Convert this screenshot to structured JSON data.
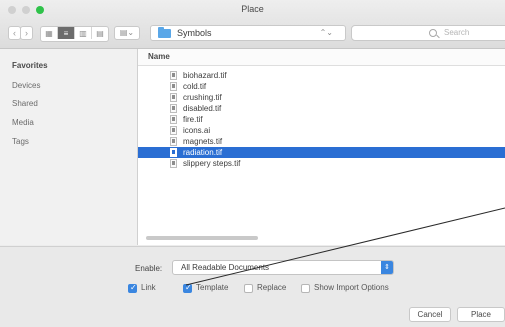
{
  "window": {
    "title": "Place"
  },
  "toolbar": {
    "back_label": "‹",
    "forward_label": "›",
    "view_icons": [
      "▦",
      "≡",
      "▥",
      "▤"
    ],
    "arrange_label": "▤⌄",
    "location": "Symbols",
    "location_arrows": "⌃⌄",
    "search_placeholder": "Search"
  },
  "sidebar": {
    "items": [
      {
        "label": "Favorites"
      },
      {
        "label": "Devices"
      },
      {
        "label": "Shared"
      },
      {
        "label": "Media"
      },
      {
        "label": "Tags"
      }
    ]
  },
  "file_list": {
    "column_header": "Name",
    "files": [
      {
        "name": "biohazard.tif",
        "selected": false
      },
      {
        "name": "cold.tif",
        "selected": false
      },
      {
        "name": "crushing.tif",
        "selected": false
      },
      {
        "name": "disabled.tif",
        "selected": false
      },
      {
        "name": "fire.tif",
        "selected": false
      },
      {
        "name": "icons.ai",
        "selected": false
      },
      {
        "name": "magnets.tif",
        "selected": false
      },
      {
        "name": "radiation.tif",
        "selected": true
      },
      {
        "name": "slippery steps.tif",
        "selected": false
      }
    ]
  },
  "options": {
    "enable_label": "Enable:",
    "enable_value": "All Readable Documents",
    "enable_arrow": "⇕",
    "link_label": "Link",
    "link_checked": true,
    "template_label": "Template",
    "template_checked": true,
    "replace_label": "Replace",
    "replace_checked": false,
    "import_label": "Show Import Options",
    "import_checked": false
  },
  "buttons": {
    "cancel": "Cancel",
    "place": "Place"
  },
  "colors": {
    "selection": "#2a6ed3",
    "accent": "#3a86e0",
    "folder": "#5aa7e8"
  }
}
